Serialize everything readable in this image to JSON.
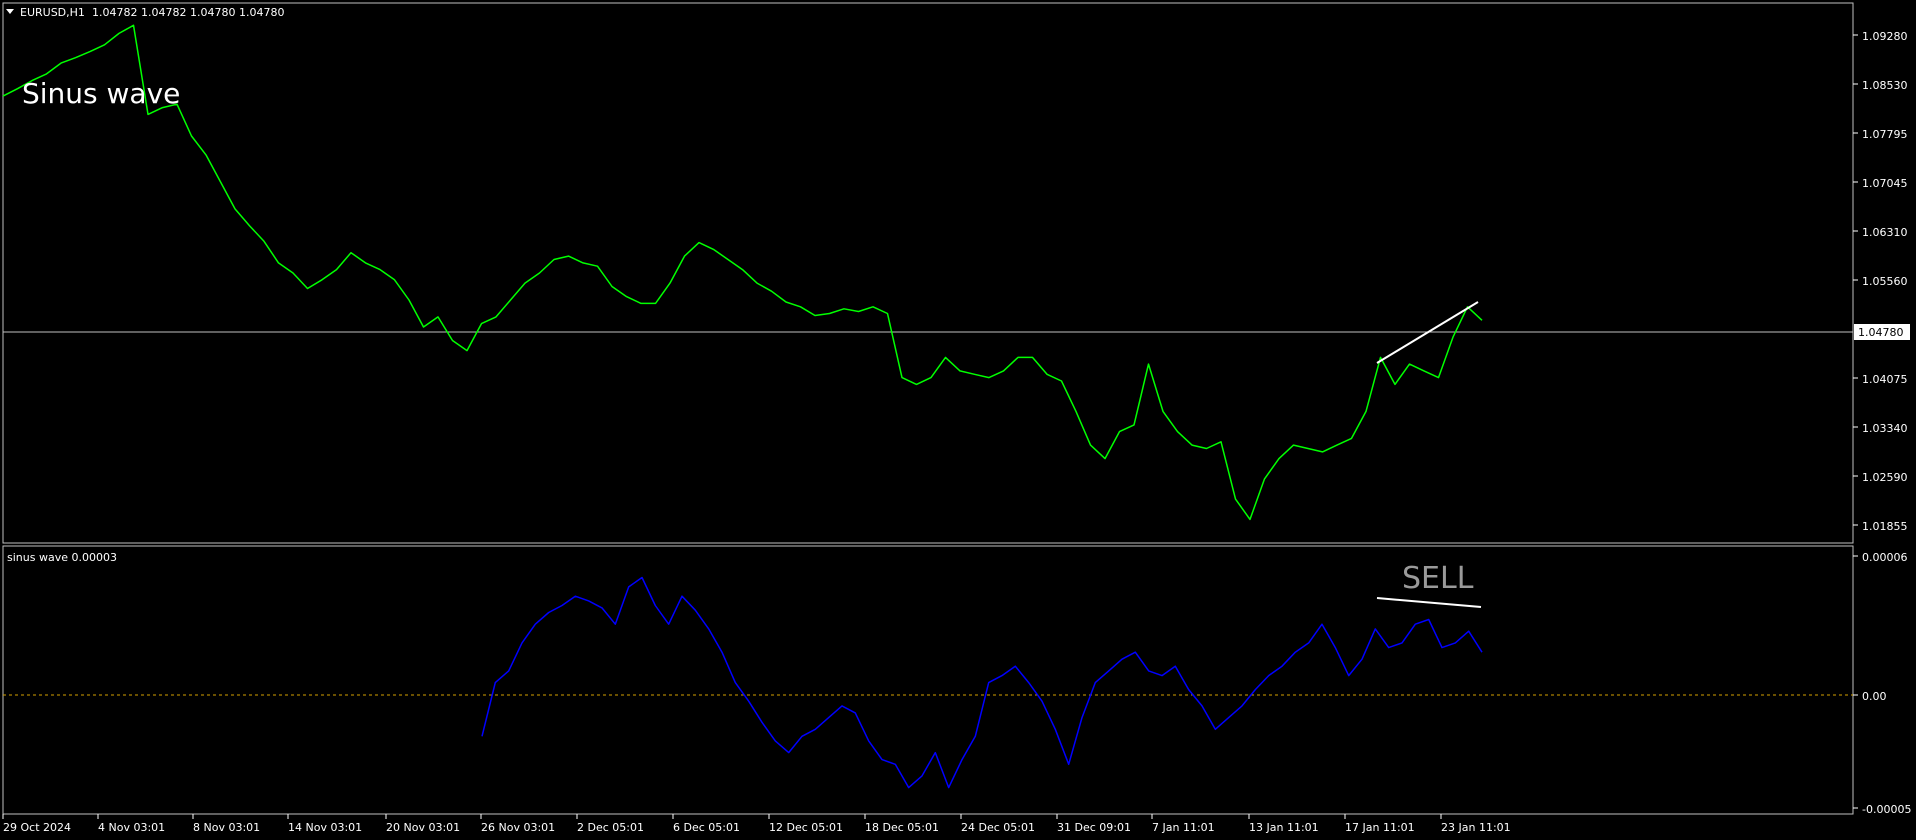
{
  "main_panel": {
    "symbol_label": "EURUSD,H1",
    "ohlc_values": "1.04782 1.04782 1.04780 1.04780",
    "title_overlay": "Sinus wave",
    "price_ticks": [
      "1.09280",
      "1.08530",
      "1.07795",
      "1.07045",
      "1.06310",
      "1.05560",
      "1.04075",
      "1.03340",
      "1.02590",
      "1.01855"
    ],
    "current_price_label": "1.04780",
    "colors": {
      "price_line": "#00ff00",
      "trend_line": "#ffffff",
      "current_price_line": "#c0c0c0",
      "background": "#000000"
    }
  },
  "indicator_panel": {
    "label": "sinus wave 0.00003",
    "signal_text": "SELL",
    "value_ticks": [
      "0.00006",
      "0.00",
      "-0.00005"
    ],
    "colors": {
      "indicator_line": "#0000ff",
      "zero_line": "#d4a000",
      "signal_text": "#9a9a9a"
    }
  },
  "time_axis": {
    "labels": [
      "29 Oct 2024",
      "4 Nov 03:01",
      "8 Nov 03:01",
      "14 Nov 03:01",
      "20 Nov 03:01",
      "26 Nov 03:01",
      "2 Dec 05:01",
      "6 Dec 05:01",
      "12 Dec 05:01",
      "18 Dec 05:01",
      "24 Dec 05:01",
      "31 Dec 09:01",
      "7 Jan 11:01",
      "13 Jan 11:01",
      "17 Jan 11:01",
      "23 Jan 11:01"
    ]
  },
  "chart_data": [
    {
      "type": "line",
      "title": "",
      "ylim": [
        1.0155,
        1.0955
      ],
      "x": [
        "29 Oct 2024",
        "4 Nov 03:01",
        "8 Nov 03:01",
        "14 Nov 03:01",
        "20 Nov 03:01",
        "26 Nov 03:01",
        "2 Dec 05:01",
        "6 Dec 05:01",
        "12 Dec 05:01",
        "18 Dec 05:01",
        "24 Dec 05:01",
        "31 Dec 09:01",
        "7 Jan 11:01",
        "13 Jan 11:01",
        "17 Jan 11:01",
        "23 Jan 11:01"
      ],
      "series": [
        {
          "values": [
            1.0817,
            1.0828,
            1.084,
            1.085,
            1.0866,
            1.0874,
            1.0883,
            1.0893,
            1.091,
            1.0922,
            1.079,
            1.08,
            1.0805,
            1.0758,
            1.073,
            1.069,
            1.065,
            1.0625,
            1.0602,
            1.057,
            1.0555,
            1.0532,
            1.0545,
            1.056,
            1.0585,
            1.057,
            1.056,
            1.0545,
            1.0515,
            1.0475,
            1.049,
            1.0455,
            1.044,
            1.048,
            1.049,
            1.0515,
            1.054,
            1.0555,
            1.0575,
            1.058,
            1.057,
            1.0565,
            1.0535,
            1.052,
            1.051,
            1.051,
            1.054,
            1.058,
            1.06,
            1.059,
            1.0575,
            1.056,
            1.054,
            1.0528,
            1.0512,
            1.0505,
            1.0492,
            1.0495,
            1.0502,
            1.0498,
            1.0505,
            1.0495,
            1.04,
            1.039,
            1.04,
            1.043,
            1.041,
            1.0405,
            1.04,
            1.041,
            1.043,
            1.043,
            1.0405,
            1.0395,
            1.035,
            1.03,
            1.028,
            1.032,
            1.033,
            1.042,
            1.035,
            1.032,
            1.03,
            1.0295,
            1.0305,
            1.022,
            1.019,
            1.025,
            1.028,
            1.03,
            1.0295,
            1.029,
            1.03,
            1.031,
            1.035,
            1.043,
            1.039,
            1.042,
            1.041,
            1.04,
            1.046,
            1.0505,
            1.0485
          ]
        }
      ],
      "trend_line": {
        "from": [
          "17 Jan 11:01",
          1.0436
        ],
        "to": [
          "23 Jan 11:01",
          1.0524
        ]
      }
    },
    {
      "type": "line",
      "title": "",
      "ylim": [
        -5.13e-05,
        6.35e-05
      ],
      "series": [
        {
          "name": "sinus wave",
          "values": [
            -1.8e-05,
            5e-06,
            1e-05,
            2.2e-05,
            3e-05,
            3.5e-05,
            3.8e-05,
            4.2e-05,
            4e-05,
            3.7e-05,
            3e-05,
            4.6e-05,
            5e-05,
            3.8e-05,
            3e-05,
            4.2e-05,
            3.6e-05,
            2.8e-05,
            1.8e-05,
            5e-06,
            -3e-06,
            -1.2e-05,
            -2e-05,
            -2.5e-05,
            -1.8e-05,
            -1.5e-05,
            -1e-05,
            -5e-06,
            -8e-06,
            -2e-05,
            -2.8e-05,
            -3e-05,
            -4e-05,
            -3.5e-05,
            -2.5e-05,
            -4e-05,
            -2.8e-05,
            -1.8e-05,
            5e-06,
            8e-06,
            1.2e-05,
            5e-06,
            -3e-06,
            -1.5e-05,
            -3e-05,
            -1e-05,
            5e-06,
            1e-05,
            1.5e-05,
            1.8e-05,
            1e-05,
            8e-06,
            1.2e-05,
            2e-06,
            -5e-06,
            -1.5e-05,
            -1e-05,
            -5e-06,
            2e-06,
            8e-06,
            1.2e-05,
            1.8e-05,
            2.2e-05,
            3e-05,
            2e-05,
            8e-06,
            1.5e-05,
            2.8e-05,
            2e-05,
            2.2e-05,
            3e-05,
            3.2e-05,
            2e-05,
            2.2e-05,
            2.7e-05,
            1.8e-05
          ]
        }
      ],
      "reference_line_value": 0.0,
      "divergence_line": {
        "from": [
          "17 Jan 11:01",
          3.45e-05
        ],
        "to": [
          "23 Jan 11:01",
          3.1e-05
        ]
      }
    }
  ]
}
